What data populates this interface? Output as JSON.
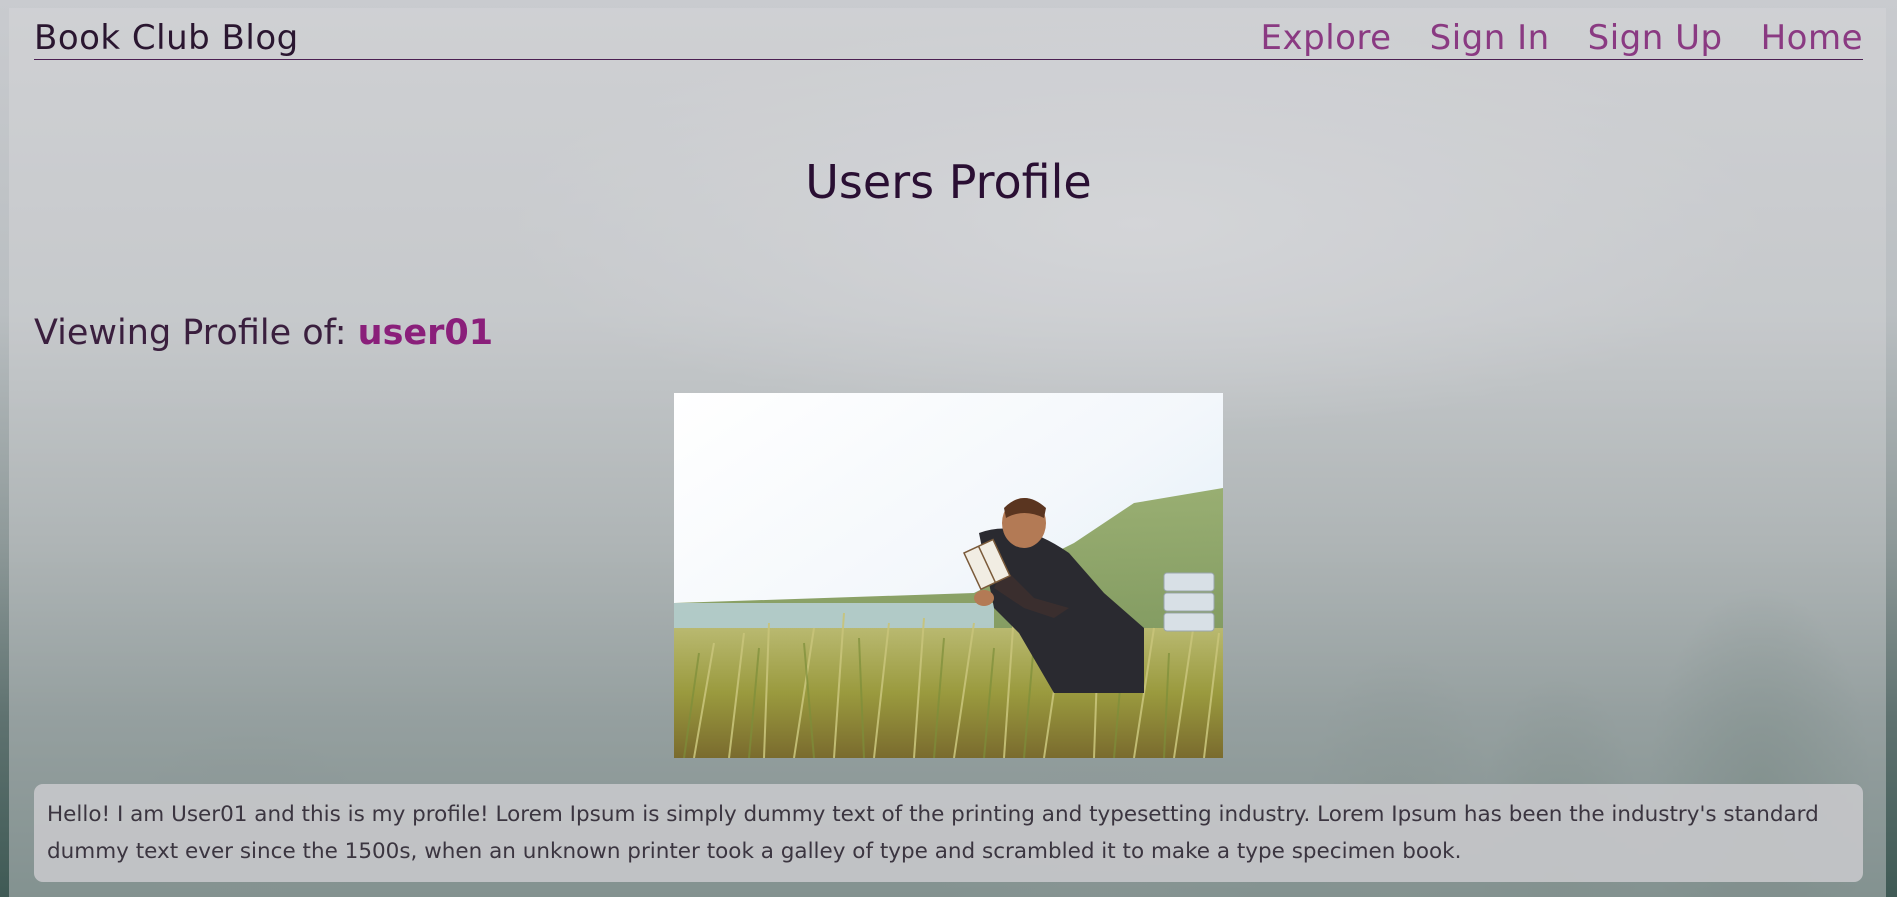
{
  "header": {
    "brand": "Book Club Blog",
    "nav": [
      "Explore",
      "Sign In",
      "Sign Up",
      "Home"
    ]
  },
  "main": {
    "title": "Users Profile",
    "viewing_prefix": "Viewing Profile of: ",
    "username": "user01",
    "bio": "Hello! I am User01 and this is my profile! Lorem Ipsum is simply dummy text of the printing and typesetting industry. Lorem Ipsum has been the industry's standard dummy text ever since the 1500s, when an unknown printer took a galley of type and scrambled it to make a type specimen book."
  },
  "colors": {
    "accent": "#8a3a82",
    "username": "#8a1f7a",
    "heading": "#2a0f33"
  }
}
